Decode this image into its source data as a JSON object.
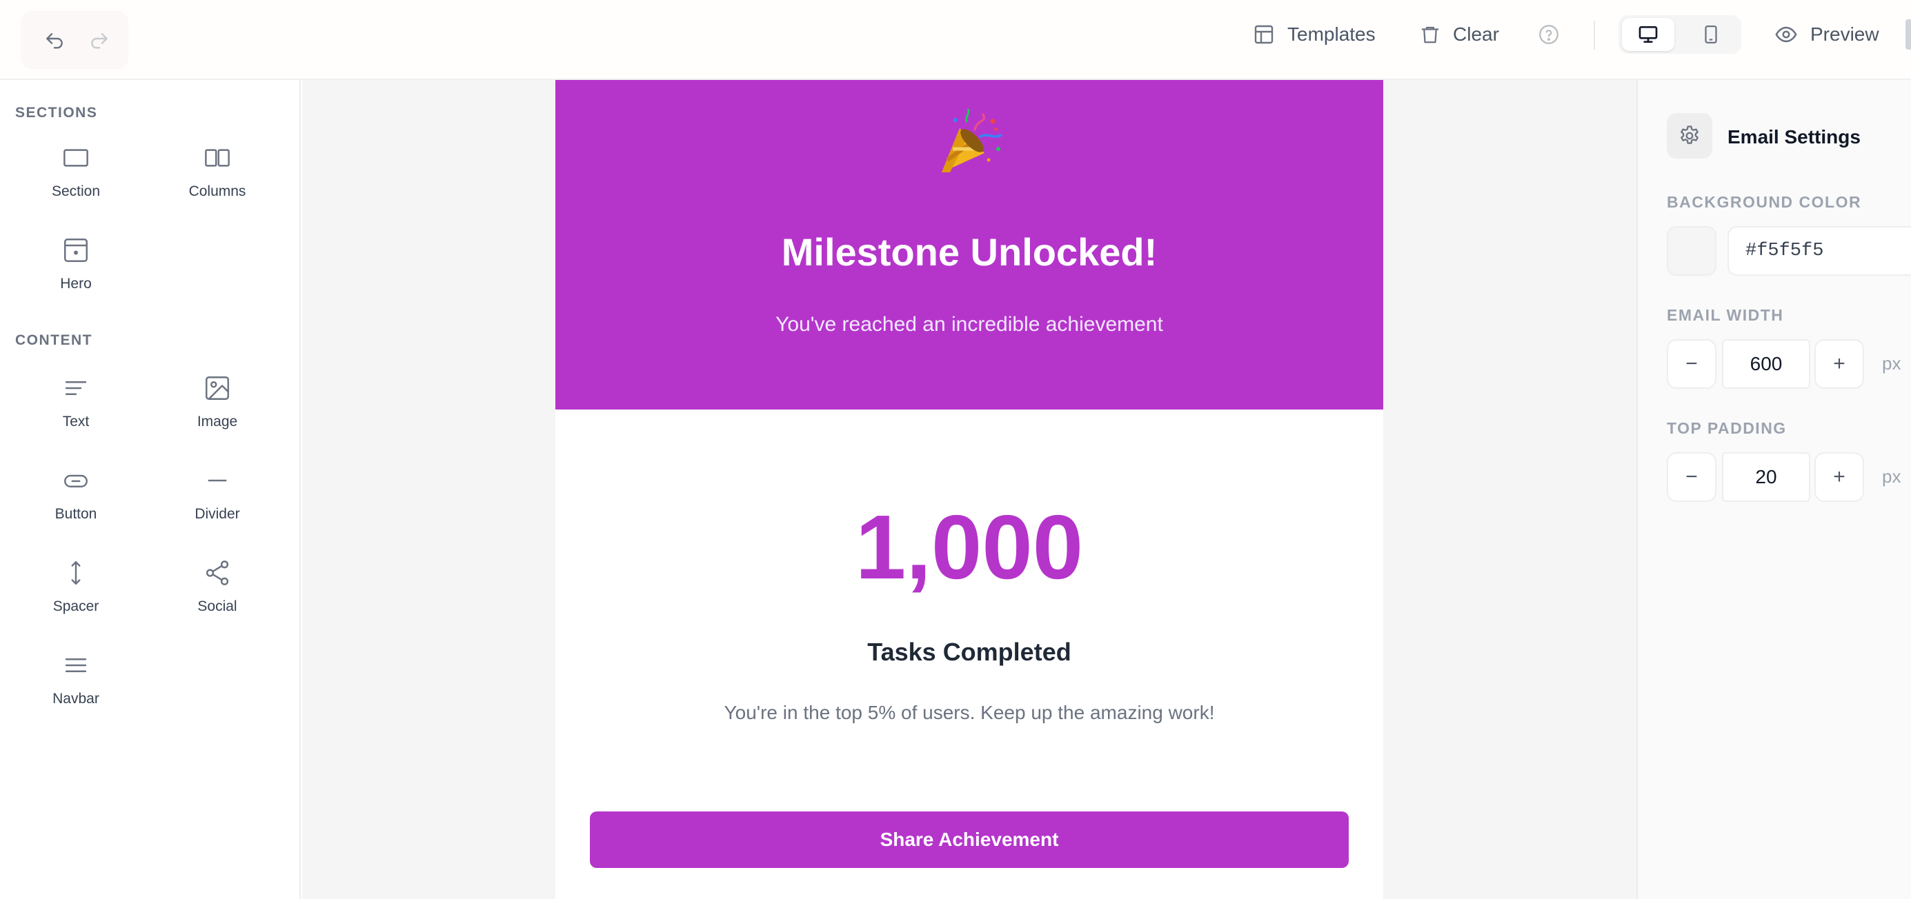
{
  "colors": {
    "accent": "#b535cb",
    "canvas_bg": "#f5f5f5"
  },
  "toolbar": {
    "undo_icon": "undo-icon",
    "redo_icon": "redo-icon",
    "templates_label": "Templates",
    "clear_label": "Clear",
    "help_icon": "help-icon",
    "device_active": "desktop",
    "preview_label": "Preview"
  },
  "sidebar": {
    "sections_heading": "SECTIONS",
    "content_heading": "CONTENT",
    "section_blocks": [
      {
        "label": "Section",
        "icon": "section-icon"
      },
      {
        "label": "Columns",
        "icon": "columns-icon"
      },
      {
        "label": "Hero",
        "icon": "hero-icon"
      }
    ],
    "content_blocks": [
      {
        "label": "Text",
        "icon": "text-icon"
      },
      {
        "label": "Image",
        "icon": "image-icon"
      },
      {
        "label": "Button",
        "icon": "button-icon"
      },
      {
        "label": "Divider",
        "icon": "divider-icon"
      },
      {
        "label": "Spacer",
        "icon": "spacer-icon"
      },
      {
        "label": "Social",
        "icon": "social-icon"
      },
      {
        "label": "Navbar",
        "icon": "navbar-icon"
      }
    ]
  },
  "email": {
    "hero_emoji": "party-popper",
    "hero_title": "Milestone Unlocked!",
    "hero_subtitle": "You've reached an incredible achievement",
    "stat_number": "1,000",
    "stat_label": "Tasks Completed",
    "stat_description": "You're in the top 5% of users. Keep up the amazing work!",
    "cta_label": "Share Achievement"
  },
  "settings": {
    "title": "Email Settings",
    "background_color_label": "BACKGROUND COLOR",
    "background_color_value": "#f5f5f5",
    "background_swatch": "#f5f5f5",
    "email_width_label": "EMAIL WIDTH",
    "email_width_value": "600",
    "email_width_unit": "px",
    "top_padding_label": "TOP PADDING",
    "top_padding_value": "20",
    "top_padding_unit": "px",
    "decrement_symbol": "−",
    "increment_symbol": "+"
  }
}
